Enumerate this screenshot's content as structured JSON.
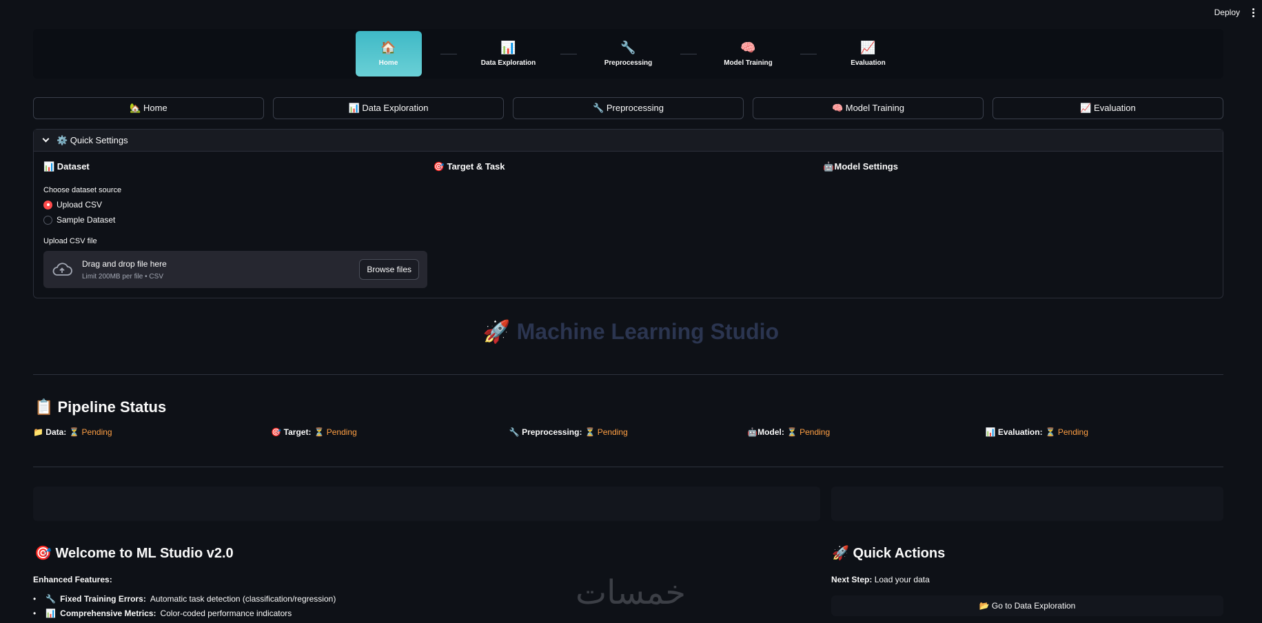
{
  "header": {
    "deploy_label": "Deploy"
  },
  "stepper": [
    {
      "icon": "🏠",
      "label": "Home",
      "active": true
    },
    {
      "icon": "📊",
      "label": "Data Exploration",
      "active": false
    },
    {
      "icon": "🔧",
      "label": "Preprocessing",
      "active": false
    },
    {
      "icon": "🧠",
      "label": "Model Training",
      "active": false
    },
    {
      "icon": "📈",
      "label": "Evaluation",
      "active": false
    }
  ],
  "nav": [
    {
      "label": "🏡 Home"
    },
    {
      "label": "📊 Data Exploration"
    },
    {
      "label": "🔧 Preprocessing"
    },
    {
      "label": "🧠 Model Training"
    },
    {
      "label": "📈 Evaluation"
    }
  ],
  "quick_settings": {
    "title": "⚙️ Quick Settings",
    "dataset_title": "📊 Dataset",
    "target_title": "🎯 Target & Task",
    "model_title": "🤖Model Settings",
    "source_label": "Choose dataset source",
    "options": [
      "Upload CSV",
      "Sample Dataset"
    ],
    "selected_option": "Upload CSV",
    "upload_label": "Upload CSV file",
    "drop_text": "Drag and drop file here",
    "drop_limit": "Limit 200MB per file • CSV",
    "browse_label": "Browse files"
  },
  "hero_title": "🚀 Machine Learning Studio",
  "pipeline": {
    "title": "📋 Pipeline Status",
    "items": [
      {
        "label": "📁 Data:",
        "status": "⏳ Pending"
      },
      {
        "label": "🎯 Target:",
        "status": "⏳ Pending"
      },
      {
        "label": "🔧 Preprocessing:",
        "status": "⏳ Pending"
      },
      {
        "label": "🤖Model:",
        "status": "⏳ Pending"
      },
      {
        "label": "📊 Evaluation:",
        "status": "⏳ Pending"
      }
    ]
  },
  "welcome": {
    "title": "🎯 Welcome to ML Studio v2.0",
    "enhanced": "Enhanced Features:",
    "features": [
      {
        "icon": "🔧",
        "title": "Fixed Training Errors:",
        "desc": "Automatic task detection (classification/regression)"
      },
      {
        "icon": "📊",
        "title": "Comprehensive Metrics:",
        "desc": "Color-coded performance indicators"
      }
    ]
  },
  "quick_actions": {
    "title": "🚀 Quick Actions",
    "next_step_label": "Next Step:",
    "next_step_value": "Load your data",
    "goto_label": "📂 Go to Data Exploration"
  },
  "watermark_text": "خمسات",
  "colors": {
    "accent": "#ff4b4b",
    "pending": "#ff9f43",
    "active_step": "#4fc3cb"
  }
}
